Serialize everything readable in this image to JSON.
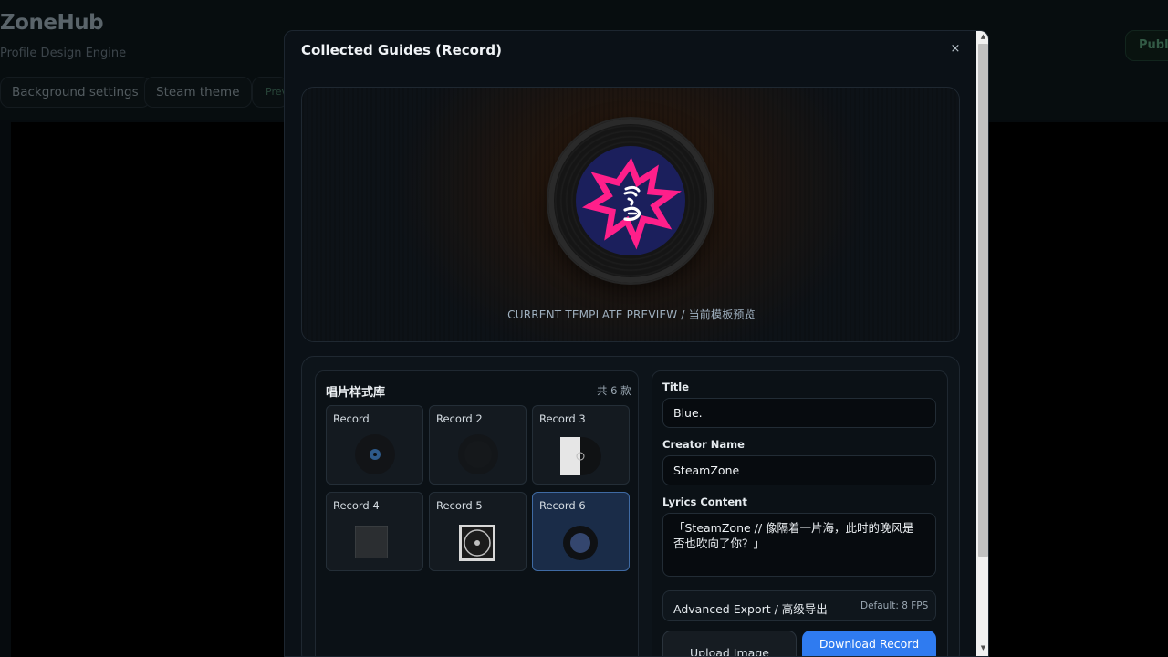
{
  "background": {
    "app_title": "ZoneHub",
    "app_subtitle": "Profile Design Engine",
    "tabs": [
      {
        "label": "Background settings"
      },
      {
        "label": "Steam theme"
      },
      {
        "label": "Prev"
      }
    ],
    "publish_label": "Publi"
  },
  "modal": {
    "title": "Collected Guides (Record)",
    "close_glyph": "×",
    "preview_caption": "CURRENT TEMPLATE PREVIEW / 当前模板预览",
    "library": {
      "title": "唱片样式库",
      "count": "共 6 款",
      "records": [
        {
          "label": "Record",
          "selected": false
        },
        {
          "label": "Record 2",
          "selected": false
        },
        {
          "label": "Record 3",
          "selected": false
        },
        {
          "label": "Record 4",
          "selected": false
        },
        {
          "label": "Record 5",
          "selected": false
        },
        {
          "label": "Record 6",
          "selected": true
        }
      ]
    },
    "form": {
      "title_label": "Title",
      "title_value": "Blue.",
      "creator_label": "Creator Name",
      "creator_value": "SteamZone",
      "lyrics_label": "Lyrics Content",
      "lyrics_value": "「SteamZone // 像隔着一片海，此时的晚风是否也吹向了你？」",
      "advanced_label": "Advanced Export / 高级导出",
      "advanced_hint": "Default: 8 FPS",
      "upload_label": "Upload Image",
      "download_label": "Download Record"
    }
  },
  "colors": {
    "accent": "#2f7bf0",
    "label_pink": "#ff1f8a",
    "label_navy": "#1b1f5c",
    "selected_card": "#1a2c48"
  },
  "icons": {
    "close": "close-icon",
    "scroll_up": "scroll-up-arrow-icon",
    "scroll_down": "scroll-down-arrow-icon"
  }
}
